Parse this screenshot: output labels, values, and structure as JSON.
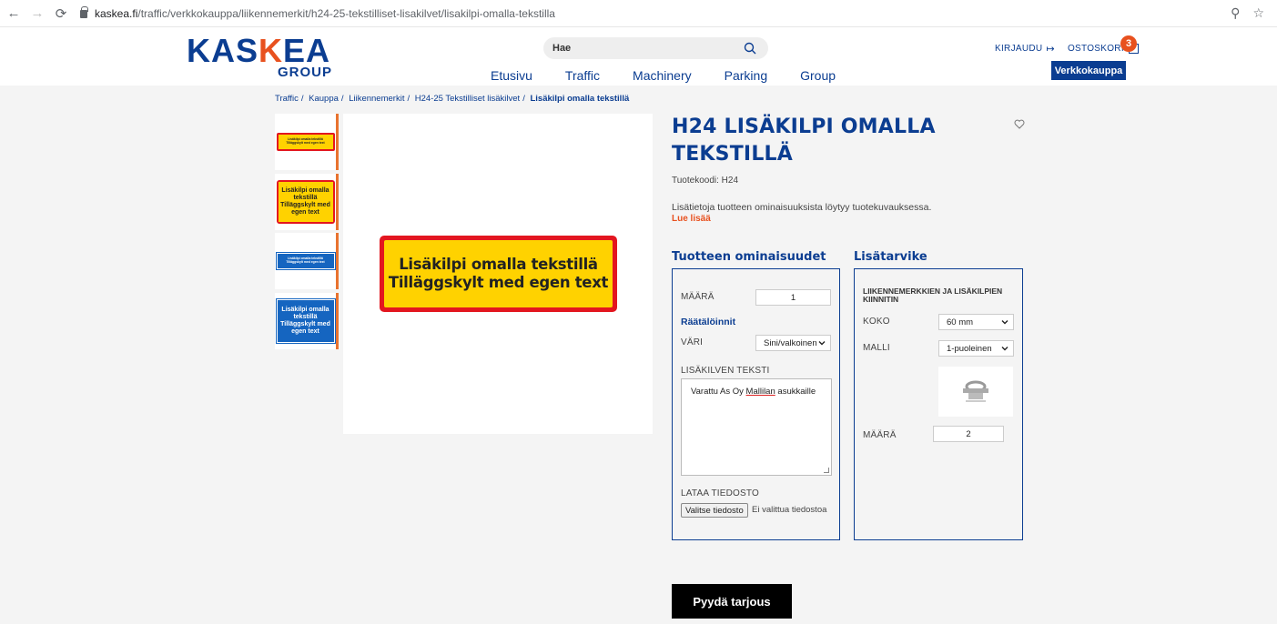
{
  "browser": {
    "url_host": "kaskea.fi",
    "url_path": "/traffic/verkkokauppa/liikennemerkit/h24-25-tekstilliset-lisakilvet/lisakilpi-omalla-tekstilla"
  },
  "header": {
    "logo_main_a": "KAS",
    "logo_main_k": "K",
    "logo_main_b": "EA",
    "logo_sub": "GROUP",
    "search_placeholder": "Hae",
    "nav": [
      "Etusivu",
      "Traffic",
      "Machinery",
      "Parking",
      "Group"
    ],
    "login_label": "KIRJAUDU",
    "cart_label": "OSTOSKORI",
    "cart_count": "3",
    "shop_button": "Verkkokauppa"
  },
  "breadcrumb": {
    "items": [
      "Traffic",
      "Kauppa",
      "Liikennemerkit",
      "H24-25 Tekstilliset lisäkilvet"
    ],
    "current": "Lisäkilpi omalla tekstillä"
  },
  "thumbnails": [
    {
      "line1": "Lisäkilpi omalla tekstillä",
      "line2": "Tilläggskylt med egen text"
    },
    {
      "line1": "Lisäkilpi omalla tekstillä",
      "line2": "Tilläggskylt med egen text"
    },
    {
      "line1": "Lisäkilpi omalla tekstillä",
      "line2": "Tilläggskylt med egen text"
    },
    {
      "line1": "Lisäkilpi omalla tekstillä",
      "line2": "Tilläggskylt med egen text"
    }
  ],
  "main_sign": {
    "line1": "Lisäkilpi omalla tekstillä",
    "line2": "Tilläggskylt med egen text"
  },
  "product": {
    "title_line1": "H24 LISÄKILPI OMALLA",
    "title_line2": "TEKSTILLÄ",
    "code": "Tuotekoodi: H24",
    "info": "Lisätietoja tuotteen ominaisuuksista löytyy tuotekuvauksessa.",
    "read_more": "Lue lisää"
  },
  "properties": {
    "title": "Tuotteen ominaisuudet",
    "qty_label": "MÄÄRÄ",
    "qty_value": "1",
    "custom_heading": "Räätälöinnit",
    "color_label": "VÄRI",
    "color_value": "Sini/valkoinen",
    "text_label": "LISÄKILVEN TEKSTI",
    "text_value_a": "Varattu As Oy ",
    "text_value_b": "Mallilan",
    "text_value_c": " asukkaille",
    "upload_label": "LATAA TIEDOSTO",
    "upload_button": "Valitse tiedosto",
    "upload_status": "Ei valittua tiedostoa"
  },
  "accessory": {
    "title": "Lisätarvike",
    "heading": "LIIKENNEMERKKIEN JA LISÄKILPIEN KIINNITIN",
    "size_label": "KOKO",
    "size_value": "60 mm",
    "model_label": "MALLI",
    "model_value": "1-puoleinen",
    "qty_label": "MÄÄRÄ",
    "qty_value": "2"
  },
  "quote_button": "Pyydä tarjous",
  "colors": {
    "brand_blue": "#0b3d91",
    "accent_orange": "#e8511f",
    "sign_red": "#e3161f",
    "sign_yellow": "#ffd200",
    "sign_blue": "#1565c0"
  }
}
